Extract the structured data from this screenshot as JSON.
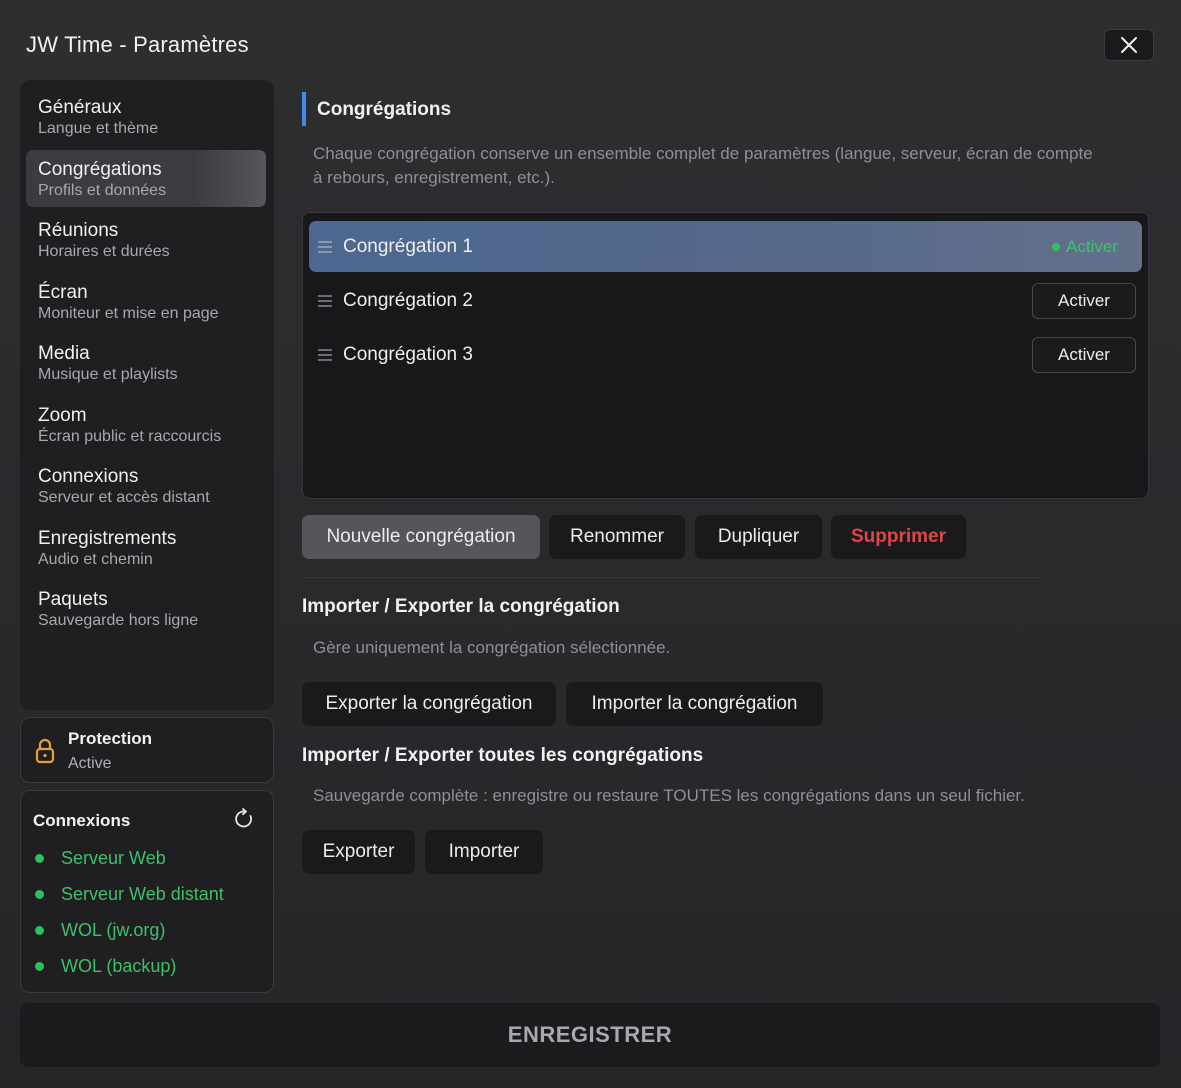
{
  "window": {
    "title": "JW Time - Paramètres",
    "close_icon": "close-icon"
  },
  "sidebar": {
    "items": [
      {
        "label": "Généraux",
        "sub": "Langue et thème"
      },
      {
        "label": "Congrégations",
        "sub": "Profils et données"
      },
      {
        "label": "Réunions",
        "sub": "Horaires et durées"
      },
      {
        "label": "Écran",
        "sub": "Moniteur et mise en page"
      },
      {
        "label": "Media",
        "sub": "Musique et playlists"
      },
      {
        "label": "Zoom",
        "sub": "Écran public et raccourcis"
      },
      {
        "label": "Connexions",
        "sub": "Serveur et accès distant"
      },
      {
        "label": "Enregistrements",
        "sub": "Audio et chemin"
      },
      {
        "label": "Paquets",
        "sub": "Sauvegarde hors ligne"
      }
    ],
    "active_index": 1
  },
  "protection": {
    "title": "Protection",
    "status": "Active",
    "icon": "lock-icon"
  },
  "connections": {
    "title": "Connexions",
    "refresh_icon": "refresh-icon",
    "items": [
      "Serveur Web",
      "Serveur Web distant",
      "WOL (jw.org)",
      "WOL (backup)"
    ],
    "status_color": "#2fbf5e"
  },
  "main": {
    "title": "Congrégations",
    "description_line1": "Chaque congrégation conserve un ensemble complet de paramètres (langue, serveur, écran de compte",
    "description_line2": "à rebours, enregistrement, etc.).",
    "congregations": [
      {
        "name": "Congrégation 1",
        "action": "Activer",
        "active": true
      },
      {
        "name": "Congrégation 2",
        "action": "Activer",
        "active": false
      },
      {
        "name": "Congrégation 3",
        "action": "Activer",
        "active": false
      }
    ],
    "buttons": {
      "new": "Nouvelle congrégation",
      "rename": "Renommer",
      "duplicate": "Dupliquer",
      "delete": "Supprimer"
    },
    "import_export_one": {
      "title": "Importer / Exporter la congrégation",
      "description": "Gère uniquement la congrégation sélectionnée.",
      "export": "Exporter la congrégation",
      "import": "Importer la congrégation"
    },
    "import_export_all": {
      "title": "Importer / Exporter toutes les congrégations",
      "description": "Sauvegarde complète : enregistre ou restaure TOUTES les congrégations dans un seul fichier.",
      "export": "Exporter",
      "import": "Importer"
    }
  },
  "footer": {
    "save": "ENREGISTRER"
  },
  "colors": {
    "accent": "#3d8cf0",
    "success": "#3cc36e",
    "danger": "#e14545",
    "lock": "#e8a13a"
  }
}
